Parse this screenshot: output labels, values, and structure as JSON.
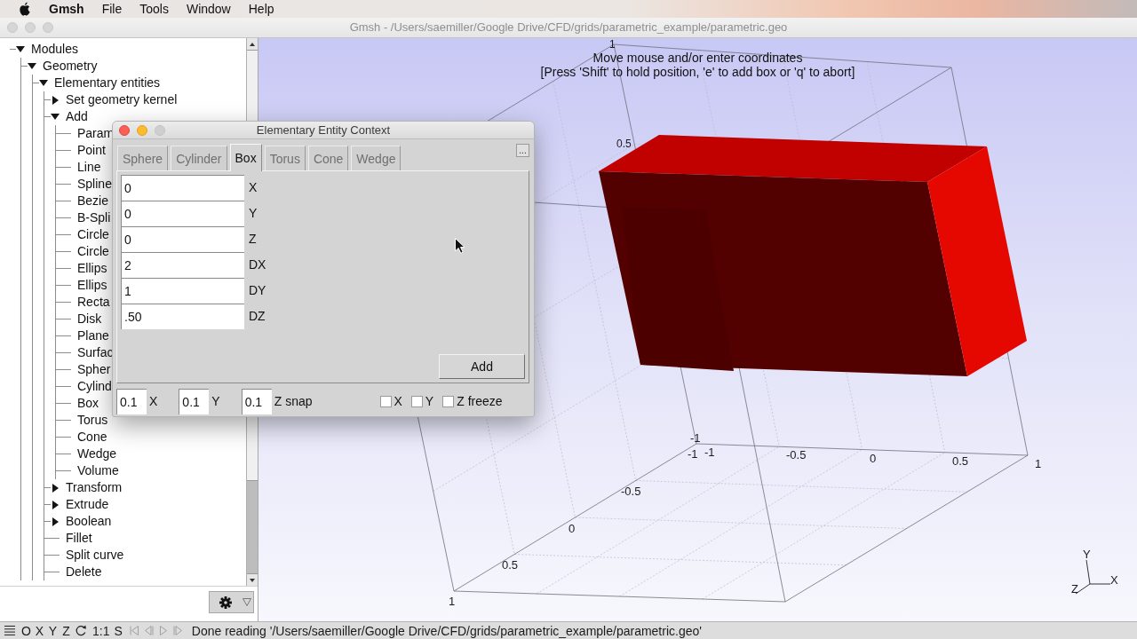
{
  "menu_bar": {
    "app": "Gmsh",
    "items": [
      "File",
      "Tools",
      "Window",
      "Help"
    ]
  },
  "window": {
    "title": "Gmsh - /Users/saemiller/Google Drive/CFD/grids/parametric_example/parametric.geo"
  },
  "tree": [
    {
      "label": "Modules",
      "kind": "branch",
      "expanded": true,
      "children": [
        {
          "label": "Geometry",
          "kind": "branch",
          "expanded": true,
          "children": [
            {
              "label": "Elementary entities",
              "kind": "branch",
              "expanded": true,
              "children": [
                {
                  "label": "Set geometry kernel",
                  "kind": "branch",
                  "expanded": false
                },
                {
                  "label": "Add",
                  "kind": "branch",
                  "expanded": true,
                  "children": [
                    {
                      "label": "Param",
                      "kind": "leaf"
                    },
                    {
                      "label": "Point",
                      "kind": "leaf"
                    },
                    {
                      "label": "Line",
                      "kind": "leaf"
                    },
                    {
                      "label": "Spline",
                      "kind": "leaf"
                    },
                    {
                      "label": "Bezie",
                      "kind": "leaf"
                    },
                    {
                      "label": "B-Spli",
                      "kind": "leaf"
                    },
                    {
                      "label": "Circle",
                      "kind": "leaf"
                    },
                    {
                      "label": "Circle",
                      "kind": "leaf"
                    },
                    {
                      "label": "Ellips",
                      "kind": "leaf"
                    },
                    {
                      "label": "Ellips",
                      "kind": "leaf"
                    },
                    {
                      "label": "Recta",
                      "kind": "leaf"
                    },
                    {
                      "label": "Disk",
                      "kind": "leaf"
                    },
                    {
                      "label": "Plane",
                      "kind": "leaf"
                    },
                    {
                      "label": "Surfac",
                      "kind": "leaf"
                    },
                    {
                      "label": "Spher",
                      "kind": "leaf"
                    },
                    {
                      "label": "Cylind",
                      "kind": "leaf"
                    },
                    {
                      "label": "Box",
                      "kind": "leaf"
                    },
                    {
                      "label": "Torus",
                      "kind": "leaf"
                    },
                    {
                      "label": "Cone",
                      "kind": "leaf"
                    },
                    {
                      "label": "Wedge",
                      "kind": "leaf"
                    },
                    {
                      "label": "Volume",
                      "kind": "leaf"
                    }
                  ]
                },
                {
                  "label": "Transform",
                  "kind": "branch",
                  "expanded": false
                },
                {
                  "label": "Extrude",
                  "kind": "branch",
                  "expanded": false
                },
                {
                  "label": "Boolean",
                  "kind": "branch",
                  "expanded": false
                },
                {
                  "label": "Fillet",
                  "kind": "leaf"
                },
                {
                  "label": "Split curve",
                  "kind": "leaf"
                },
                {
                  "label": "Delete",
                  "kind": "leaf"
                }
              ]
            }
          ]
        }
      ]
    }
  ],
  "view": {
    "prompt": "Move mouse and/or enter coordinates",
    "hint": "[Press 'Shift' to hold position, 'e' to add box or 'q' to abort]",
    "tick_labels": [
      "1",
      "0.5",
      "-1",
      "-1",
      "-1",
      "-0.5",
      "0",
      "0.5",
      "1",
      "-0.5",
      "0",
      "0.5",
      "1"
    ],
    "axes_labels": [
      "Y",
      "X",
      "Z"
    ]
  },
  "dialog": {
    "title": "Elementary Entity Context",
    "tabs": [
      {
        "label": "Sphere",
        "selected": false,
        "disabled": true
      },
      {
        "label": "Cylinder",
        "selected": false,
        "disabled": true
      },
      {
        "label": "Box",
        "selected": true,
        "disabled": false
      },
      {
        "label": "Torus",
        "selected": false,
        "disabled": true
      },
      {
        "label": "Cone",
        "selected": false,
        "disabled": true
      },
      {
        "label": "Wedge",
        "selected": false,
        "disabled": true
      }
    ],
    "more_button": "...",
    "fields": [
      {
        "value": "0",
        "label": "X"
      },
      {
        "value": "0",
        "label": "Y"
      },
      {
        "value": "0",
        "label": "Z"
      },
      {
        "value": "2",
        "label": "DX"
      },
      {
        "value": "1",
        "label": "DY"
      },
      {
        "value": ".50",
        "label": "DZ"
      }
    ],
    "add_button": "Add",
    "snap": [
      {
        "value": "0.1",
        "label": "X"
      },
      {
        "value": "0.1",
        "label": "Y"
      },
      {
        "value": "0.1",
        "label": "Z snap"
      }
    ],
    "freeze": [
      {
        "label": "X",
        "checked": false
      },
      {
        "label": "Y",
        "checked": false
      },
      {
        "label": "Z freeze",
        "checked": false
      }
    ]
  },
  "status_bar": {
    "view_buttons": [
      "O",
      "X",
      "Y",
      "Z"
    ],
    "scale_buttons": [
      "1:1",
      "S"
    ],
    "playback": {
      "disabled": true
    },
    "message": "Done reading '/Users/saemiller/Google Drive/CFD/grids/parametric_example/parametric.geo'"
  }
}
